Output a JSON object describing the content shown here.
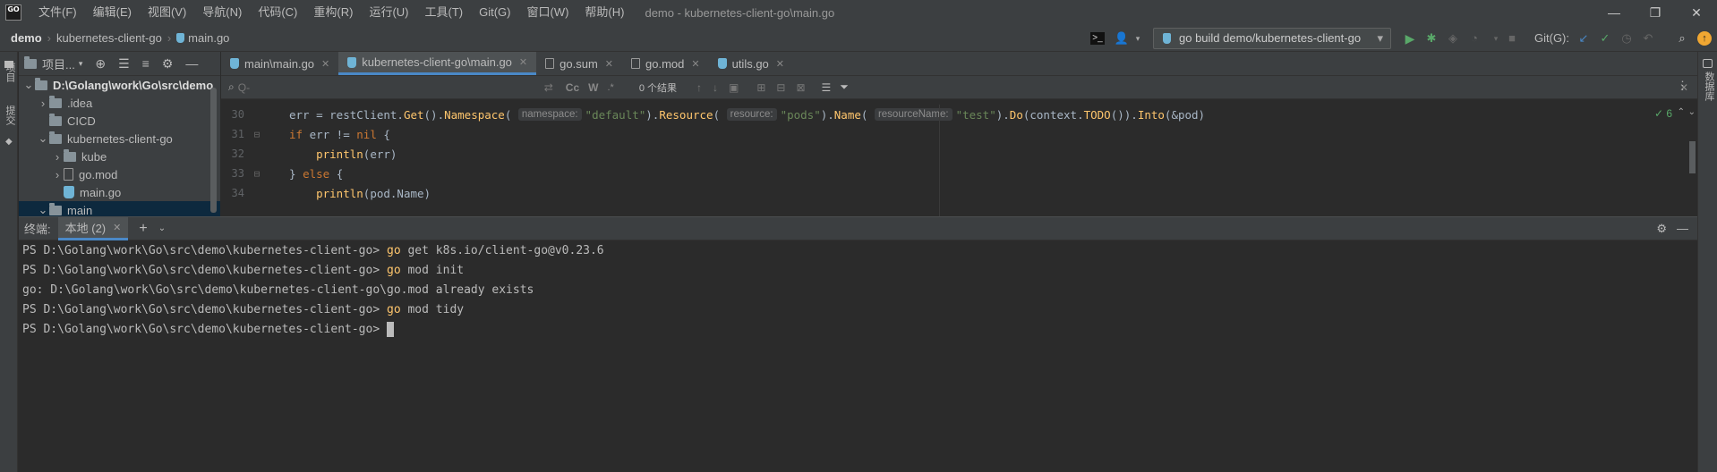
{
  "titlebar": {
    "logo_text": "GO",
    "menus": [
      "文件(F)",
      "编辑(E)",
      "视图(V)",
      "导航(N)",
      "代码(C)",
      "重构(R)",
      "运行(U)",
      "工具(T)",
      "Git(G)",
      "窗口(W)",
      "帮助(H)"
    ],
    "window_title": "demo - kubernetes-client-go\\main.go",
    "controls": [
      "—",
      "❐",
      "✕"
    ]
  },
  "navbar": {
    "crumbs": [
      "demo",
      "kubernetes-client-go",
      "main.go"
    ],
    "run_config": "go build demo/kubernetes-client-go",
    "git_label": "Git(G):"
  },
  "left_strip": {
    "project": "项目",
    "commit": "提交"
  },
  "right_strip": {
    "database": "数据库"
  },
  "project_panel": {
    "header": "项目...",
    "tree": [
      {
        "label": "D:\\Golang\\work\\Go\\src\\demo",
        "type": "folder",
        "depth": 0,
        "expanded": true,
        "bold": true
      },
      {
        "label": ".idea",
        "type": "folder",
        "depth": 1,
        "expanded": false
      },
      {
        "label": "CICD",
        "type": "folder",
        "depth": 1,
        "leaf": true
      },
      {
        "label": "kubernetes-client-go",
        "type": "folder",
        "depth": 1,
        "expanded": true
      },
      {
        "label": "kube",
        "type": "folder",
        "depth": 2,
        "expanded": false
      },
      {
        "label": "go.mod",
        "type": "mod",
        "depth": 2,
        "expanded": false
      },
      {
        "label": "main.go",
        "type": "go",
        "depth": 2,
        "leaf": true
      },
      {
        "label": "main",
        "type": "folder",
        "depth": 1,
        "expanded": true
      }
    ]
  },
  "editor": {
    "tabs": [
      {
        "label": "main\\main.go",
        "icon": "go",
        "active": false
      },
      {
        "label": "kubernetes-client-go\\main.go",
        "icon": "go",
        "active": true
      },
      {
        "label": "go.sum",
        "icon": "mod",
        "active": false
      },
      {
        "label": "go.mod",
        "icon": "mod",
        "active": false
      },
      {
        "label": "utils.go",
        "icon": "go",
        "active": false
      }
    ],
    "find": {
      "placeholder": "Q-",
      "cc": "Cc",
      "w": "W",
      "regex": ".*",
      "results": "0 个结果"
    },
    "inspections": "✓ 6",
    "lines": [
      {
        "no": "30",
        "parts": [
          [
            "plain",
            "err = restClient."
          ],
          [
            "fn",
            "Get"
          ],
          [
            "plain",
            "()."
          ],
          [
            "fn",
            "Namespace"
          ],
          [
            "plain",
            "( "
          ],
          [
            "hint",
            "namespace:"
          ],
          [
            "str",
            "\"default\""
          ],
          [
            "plain",
            ")."
          ],
          [
            "fn",
            "Resource"
          ],
          [
            "plain",
            "( "
          ],
          [
            "hint",
            "resource:"
          ],
          [
            "str",
            "\"pods\""
          ],
          [
            "plain",
            ")."
          ],
          [
            "fn",
            "Name"
          ],
          [
            "plain",
            "( "
          ],
          [
            "hint",
            "resourceName:"
          ],
          [
            "str",
            "\"test\""
          ],
          [
            "plain",
            ")."
          ],
          [
            "fn",
            "Do"
          ],
          [
            "plain",
            "(context."
          ],
          [
            "fn",
            "TODO"
          ],
          [
            "plain",
            "())."
          ],
          [
            "fn",
            "Into"
          ],
          [
            "plain",
            "(&pod)"
          ]
        ]
      },
      {
        "no": "31",
        "parts": [
          [
            "kw",
            "if "
          ],
          [
            "plain",
            "err != "
          ],
          [
            "kw",
            "nil "
          ],
          [
            "plain",
            "{"
          ]
        ]
      },
      {
        "no": "32",
        "parts": [
          [
            "plain",
            "    "
          ],
          [
            "fn",
            "println"
          ],
          [
            "plain",
            "(err)"
          ]
        ]
      },
      {
        "no": "33",
        "parts": [
          [
            "plain",
            "} "
          ],
          [
            "kw",
            "else "
          ],
          [
            "plain",
            "{"
          ]
        ]
      },
      {
        "no": "34",
        "parts": [
          [
            "plain",
            "    "
          ],
          [
            "fn",
            "println"
          ],
          [
            "plain",
            "(pod.Name)"
          ]
        ]
      }
    ]
  },
  "terminal": {
    "label": "终端:",
    "tab": "本地 (2)",
    "lines": [
      {
        "prompt": "PS D:\\Golang\\work\\Go\\src\\demo\\kubernetes-client-go> ",
        "cmd": "go",
        "rest": " get k8s.io/client-go@v0.23.6"
      },
      {
        "prompt": "PS D:\\Golang\\work\\Go\\src\\demo\\kubernetes-client-go> ",
        "cmd": "go",
        "rest": " mod init"
      },
      {
        "prompt": "go: D:\\Golang\\work\\Go\\src\\demo\\kubernetes-client-go\\go.mod already exists",
        "cmd": "",
        "rest": ""
      },
      {
        "prompt": "PS D:\\Golang\\work\\Go\\src\\demo\\kubernetes-client-go> ",
        "cmd": "go",
        "rest": " mod tidy"
      },
      {
        "prompt": "PS D:\\Golang\\work\\Go\\src\\demo\\kubernetes-client-go> ",
        "cmd": "",
        "rest": "",
        "cursor": true
      }
    ]
  },
  "colors": {
    "accent": "#4a88c7",
    "keyword": "#cc7832",
    "string": "#6a8759",
    "function": "#ffc66d",
    "run_green": "#59a869",
    "warn_orange": "#f0a732"
  }
}
